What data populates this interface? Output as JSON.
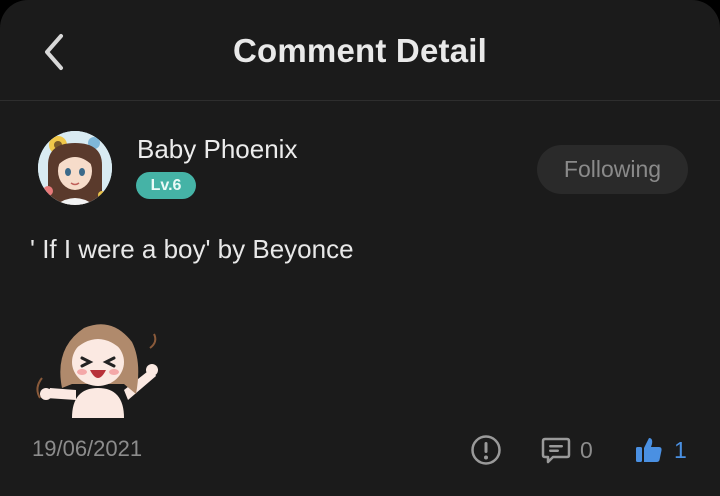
{
  "header": {
    "title": "Comment Detail",
    "back_icon": "chevron-left-icon"
  },
  "author": {
    "name": "Baby Phoenix",
    "level": "Lv.6",
    "follow_label": "Following"
  },
  "comment": {
    "text": "' If I were a boy' by Beyonce",
    "sticker": "anime-girl-sticker"
  },
  "footer": {
    "date": "19/06/2021",
    "report_icon": "exclamation-circle-icon",
    "comment_icon": "comment-icon",
    "comment_count": "0",
    "like_icon": "thumbs-up-icon",
    "like_count": "1"
  },
  "colors": {
    "background": "#1b1b1b",
    "level_badge": "#45b3a6",
    "like_accent": "#4a90e2",
    "muted_text": "#8c8c8c"
  }
}
